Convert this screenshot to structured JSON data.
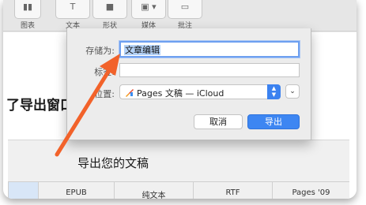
{
  "toolbar": {
    "items": [
      {
        "label": "图表",
        "icon": "chart-icon"
      },
      {
        "label": "文本",
        "icon": "text-icon"
      },
      {
        "label": "形状",
        "icon": "shape-icon"
      },
      {
        "label": "媒体",
        "icon": "media-icon"
      },
      {
        "label": "批注",
        "icon": "comment-icon"
      }
    ]
  },
  "document": {
    "heading": "了导出窗口",
    "export_panel_title": "导出您的文稿",
    "format_tabs": [
      "EPUB",
      "纯文本",
      "RTF",
      "Pages '09"
    ]
  },
  "dialog": {
    "save_as_label": "存储为:",
    "save_as_value": "文章编辑",
    "tags_label": "标签:",
    "tags_value": "",
    "where_label": "位置:",
    "where_value": "Pages 文稿 — iCloud",
    "cancel_label": "取消",
    "export_label": "导出"
  },
  "annotation": {
    "color": "#f2622a",
    "icon": "red-arrow-annotation"
  }
}
